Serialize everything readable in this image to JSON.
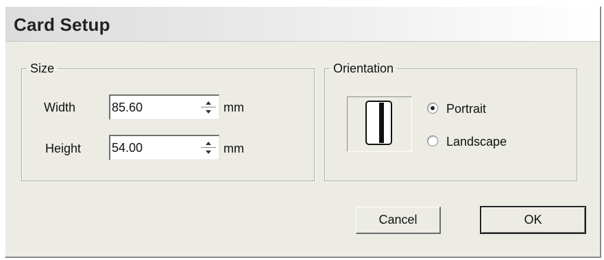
{
  "window": {
    "title": "Card Setup"
  },
  "size_group": {
    "legend": "Size",
    "width": {
      "label": "Width",
      "value": "85.60",
      "unit": "mm"
    },
    "height": {
      "label": "Height",
      "value": "54.00",
      "unit": "mm"
    }
  },
  "orientation_group": {
    "legend": "Orientation",
    "options": [
      {
        "label": "Portrait",
        "selected": true
      },
      {
        "label": "Landscape",
        "selected": false
      }
    ]
  },
  "buttons": {
    "cancel_label": "Cancel",
    "ok_label": "OK"
  },
  "icons": {
    "spinner": "spinner-arrows-icon",
    "preview": "card-portrait-icon"
  }
}
